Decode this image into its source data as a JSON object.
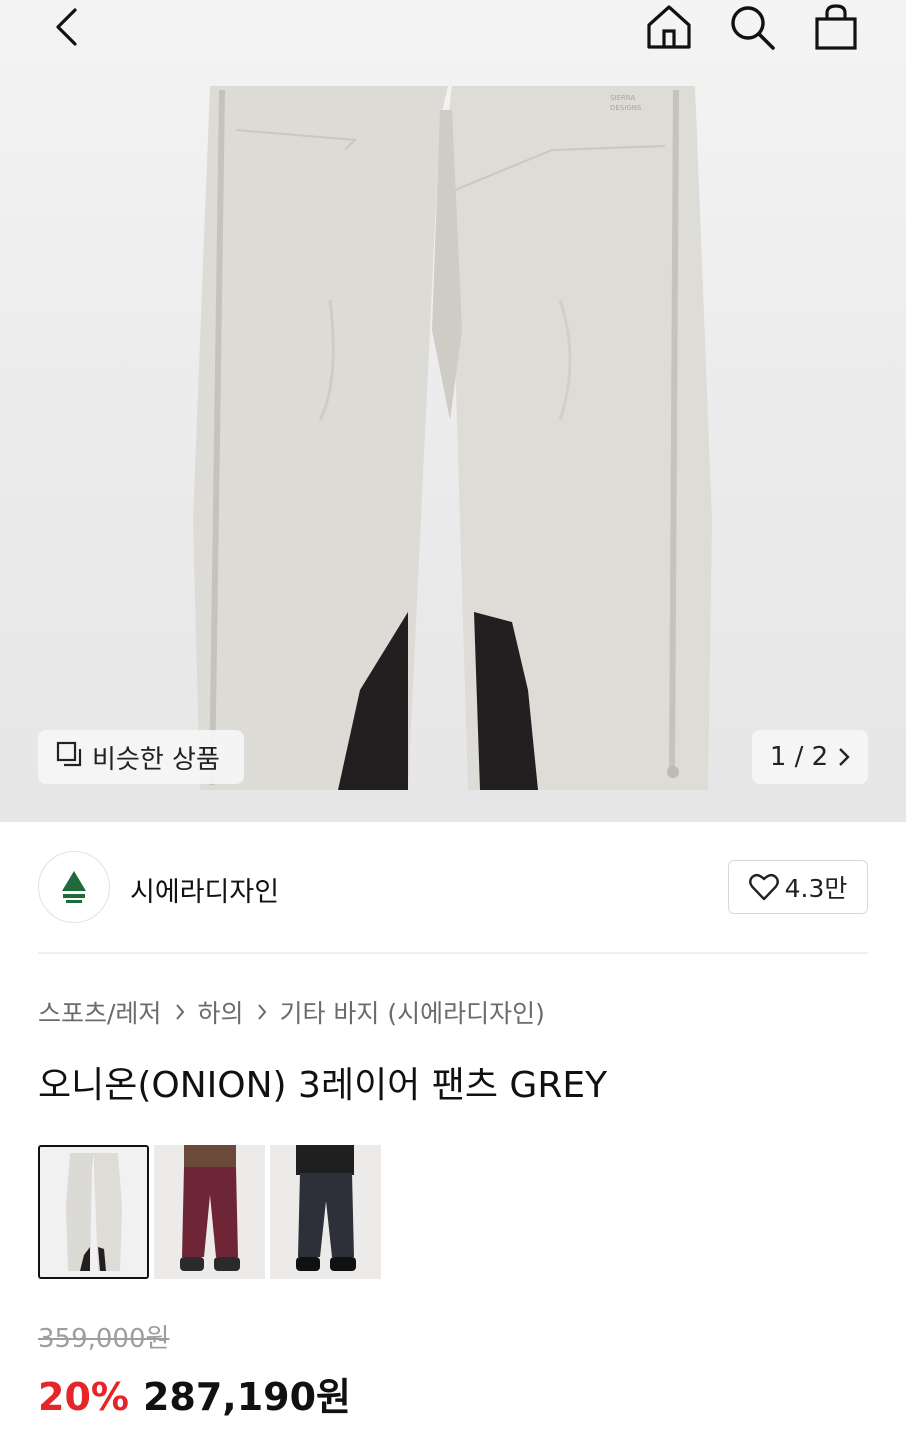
{
  "nav": {
    "back_icon": "chevron-left-icon",
    "home_icon": "home-icon",
    "search_icon": "search-icon",
    "bag_icon": "shopping-bag-icon"
  },
  "hero": {
    "similar_label": "비슷한 상품",
    "pager_label": "1 / 2",
    "product_image": "grey-onion-3layer-pants"
  },
  "seller": {
    "name": "시에라디자인",
    "like_count": "4.3만"
  },
  "breadcrumb": [
    "스포츠/레저",
    "하의",
    "기타 바지 (시에라디자인)"
  ],
  "product": {
    "title": "오니온(ONION) 3레이어 팬츠 GREY",
    "original_price": "359,000원",
    "discount": "20%",
    "sale_price": "287,190원"
  },
  "thumbnails": [
    {
      "name": "grey-pants-flat",
      "active": true
    },
    {
      "name": "burgundy-pants-model",
      "active": false
    },
    {
      "name": "black-pants-model",
      "active": false
    }
  ],
  "colors": {
    "accent_red": "#e52528",
    "pants_grey": "#dcdad5",
    "panel_black": "#231f20"
  }
}
